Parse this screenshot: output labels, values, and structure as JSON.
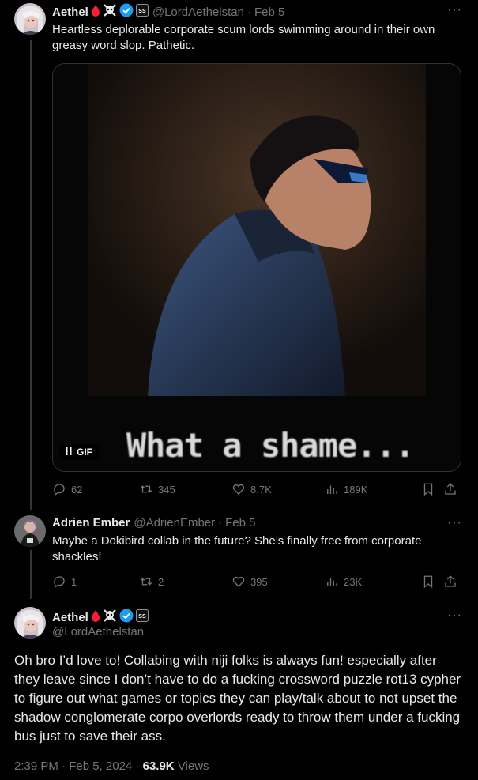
{
  "tweet1": {
    "name": "Aethel",
    "handle": "@LordAethelstan",
    "date": "Feb 5",
    "text": "Heartless deplorable corporate scum lords swimming around in their own greasy word slop. Pathetic.",
    "media": {
      "caption": "What a shame...",
      "badge": "GIF"
    },
    "stats": {
      "replies": "62",
      "retweets": "345",
      "likes": "8.7K",
      "views": "189K"
    }
  },
  "tweet2": {
    "name": "Adrien Ember",
    "handle": "@AdrienEmber",
    "date": "Feb 5",
    "text": "Maybe a Dokibird collab in the future? She’s finally free from corporate shackles!",
    "stats": {
      "replies": "1",
      "retweets": "2",
      "likes": "395",
      "views": "23K"
    }
  },
  "tweet3": {
    "name": "Aethel",
    "handle": "@LordAethelstan",
    "text": "Oh bro I’d love to! Collabing with niji folks is always fun! especially after they leave since I don’t have to do a fucking crossword puzzle rot13 cypher to figure out what games or topics they can play/talk about to not upset the shadow conglomerate corpo overlords ready to throw them under a fucking bus just to save their ass.",
    "time": "2:39 PM · Feb 5, 2024",
    "views_count": "63.9K",
    "views_label": "Views"
  },
  "separator": "·",
  "colors": {
    "background": "#000000",
    "text": "#e7e9ea",
    "muted": "#71767b",
    "verified": "#1d9bf0",
    "blood": "#f4212e"
  }
}
